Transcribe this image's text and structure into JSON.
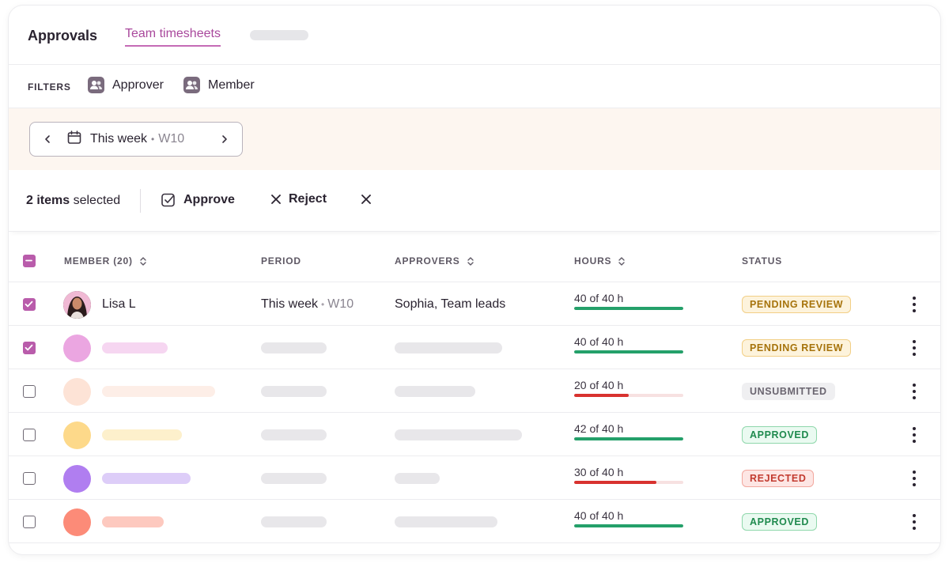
{
  "tabs": {
    "approvals": "Approvals",
    "team_timesheets": "Team timesheets"
  },
  "filters": {
    "label": "FILTERS",
    "approver": "Approver",
    "member": "Member"
  },
  "week_picker": {
    "label": "This week",
    "week": "W10",
    "separator": "•"
  },
  "selection": {
    "count": "2 items",
    "suffix": " selected",
    "approve": "Approve",
    "reject": "Reject"
  },
  "table": {
    "headers": {
      "member": "MEMBER (20)",
      "period": "PERIOD",
      "approvers": "APPROVERS",
      "hours": "HOURS",
      "status": "STATUS"
    },
    "rows": [
      {
        "name": "Lisa L",
        "period": "This week",
        "week": "W10",
        "approvers": "Sophia, Team leads",
        "hours_text": "40 of 40 h",
        "hours_fraction": 1.0,
        "status": "PENDING REVIEW",
        "checked": true
      },
      {
        "hours_text": "40 of 40 h",
        "hours_fraction": 1.0,
        "status": "PENDING REVIEW",
        "checked": true,
        "avatar_color": "#eba6e1",
        "name_skeleton_color": "#f6d6f1"
      },
      {
        "hours_text": "20 of 40 h",
        "hours_fraction": 0.5,
        "status": "UNSUBMITTED",
        "checked": false,
        "avatar_color": "#fde3d6",
        "name_skeleton_color": "#fdeee7"
      },
      {
        "hours_text": "42 of 40 h",
        "hours_fraction": 1.0,
        "status": "APPROVED",
        "checked": false,
        "avatar_color": "#fdd98a",
        "name_skeleton_color": "#fdf0cc"
      },
      {
        "hours_text": "30 of 40 h",
        "hours_fraction": 0.75,
        "status": "REJECTED",
        "checked": false,
        "avatar_color": "#b07ef0",
        "name_skeleton_color": "#ddcdf8"
      },
      {
        "hours_text": "40 of 40 h",
        "hours_fraction": 1.0,
        "status": "APPROVED",
        "checked": false,
        "avatar_color": "#fc8b78",
        "name_skeleton_color": "#fdc9bf"
      }
    ]
  },
  "colors": {
    "accent": "#b95cab",
    "progress_ok": "#24a06a",
    "progress_low": "#d8322f",
    "pending_bg": "#fdf3dc",
    "pending_fg": "#a6730b",
    "pending_border": "#f2cf86",
    "unsubmitted_bg": "#efeff1",
    "unsubmitted_fg": "#6a6570",
    "approved_bg": "#eafaf1",
    "approved_fg": "#1f8a4e",
    "approved_border": "#8fd7ab",
    "rejected_bg": "#fde6e4",
    "rejected_fg": "#c23a2f",
    "rejected_border": "#f2a79e"
  }
}
